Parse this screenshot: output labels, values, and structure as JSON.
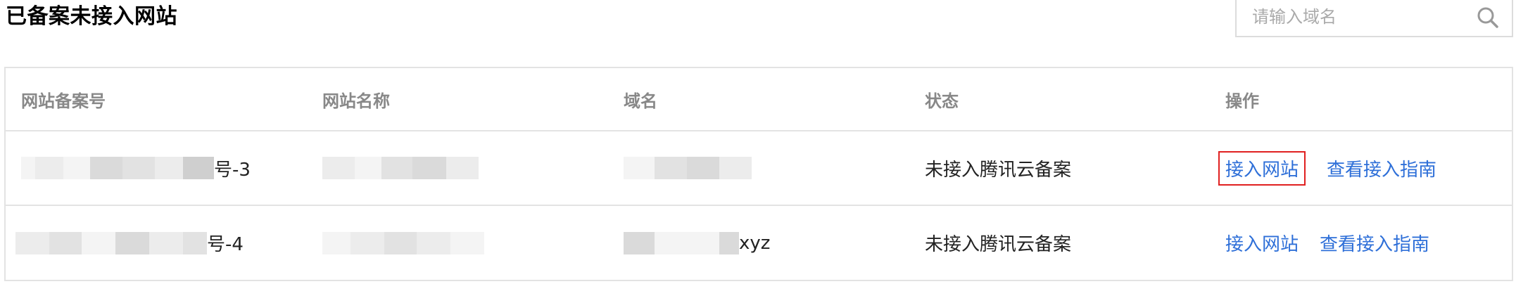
{
  "header": {
    "title": "已备案未接入网站",
    "search": {
      "placeholder": "请输入域名",
      "value": ""
    }
  },
  "table": {
    "columns": [
      "网站备案号",
      "网站名称",
      "域名",
      "状态",
      "操作"
    ],
    "rows": [
      {
        "record_suffix": "号-3",
        "domain_suffix": "",
        "status": "未接入腾讯云备案",
        "actions": {
          "connect": "接入网站",
          "guide": "查看接入指南"
        }
      },
      {
        "record_suffix": "号-4",
        "domain_suffix": "xyz",
        "status": "未接入腾讯云备案",
        "actions": {
          "connect": "接入网站",
          "guide": "查看接入指南"
        }
      }
    ]
  },
  "icons": {
    "search": "search-icon"
  },
  "colors": {
    "link": "#2e6fd8",
    "highlight_border": "#e02020",
    "header_text": "#888888"
  }
}
